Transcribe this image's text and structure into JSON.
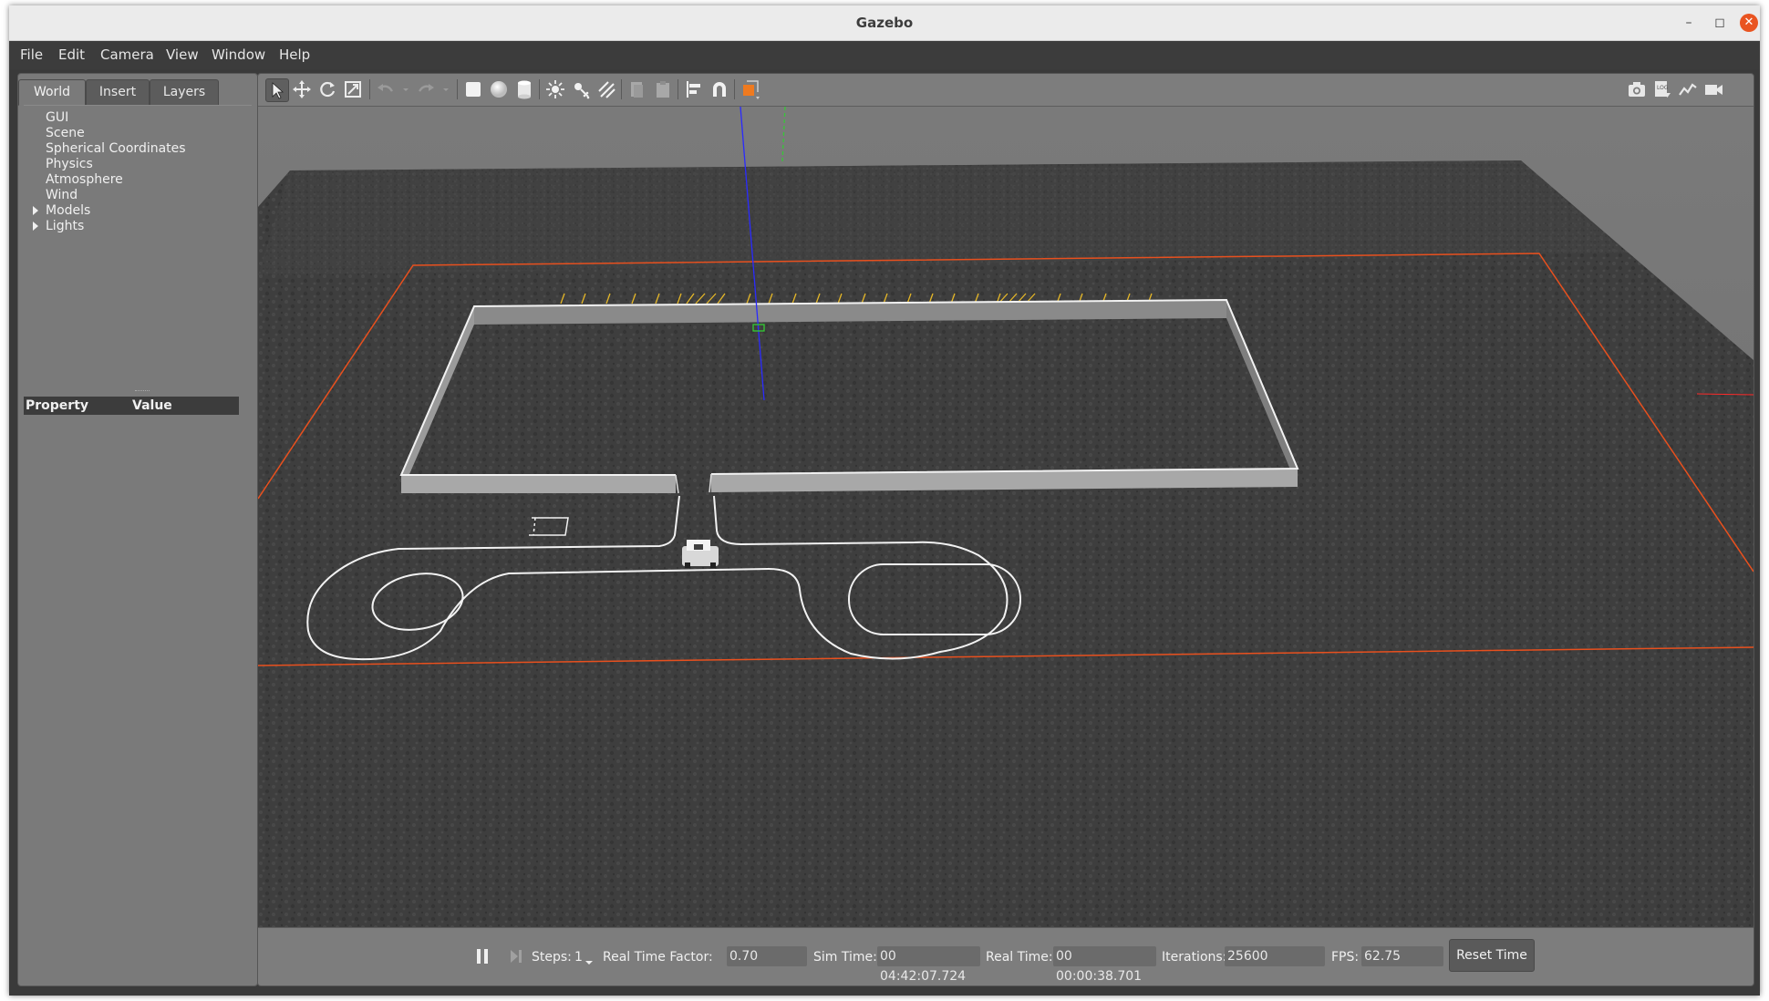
{
  "window": {
    "title": "Gazebo"
  },
  "menu": [
    {
      "label": "File"
    },
    {
      "label": "Edit"
    },
    {
      "label": "Camera"
    },
    {
      "label": "View"
    },
    {
      "label": "Window"
    },
    {
      "label": "Help"
    }
  ],
  "left_panel": {
    "tabs": [
      "World",
      "Insert",
      "Layers"
    ],
    "active_tab": "World",
    "tree": [
      {
        "label": "GUI"
      },
      {
        "label": "Scene"
      },
      {
        "label": "Spherical Coordinates"
      },
      {
        "label": "Physics"
      },
      {
        "label": "Atmosphere"
      },
      {
        "label": "Wind"
      },
      {
        "label": "Models",
        "expandable": true
      },
      {
        "label": "Lights",
        "expandable": true
      }
    ],
    "property_header": {
      "property": "Property",
      "value": "Value"
    }
  },
  "toolbar": {
    "left_icons": [
      "select-arrow-icon",
      "translate-icon",
      "rotate-icon",
      "scale-icon",
      "undo-icon",
      "undo-dropdown-icon",
      "redo-icon",
      "redo-dropdown-icon",
      "box-icon",
      "sphere-icon",
      "cylinder-icon",
      "point-light-icon",
      "spot-light-icon",
      "directional-light-icon",
      "copy-icon",
      "paste-icon",
      "align-icon",
      "snap-magnet-icon",
      "change-view-icon"
    ],
    "right_icons": [
      "screenshot-icon",
      "log-icon",
      "plot-icon",
      "record-video-icon"
    ]
  },
  "status": {
    "steps_label": "Steps:",
    "steps_value": "1",
    "rtf_label": "Real Time Factor:",
    "rtf_value": "0.70",
    "sim_time_label": "Sim Time:",
    "sim_time_value": "00 04:42:07.724",
    "real_time_label": "Real Time:",
    "real_time_value": "00 00:00:38.701",
    "iterations_label": "Iterations:",
    "iterations_value": "25600",
    "fps_label": "FPS:",
    "fps_value": "62.75",
    "reset_label": "Reset Time"
  },
  "colors": {
    "ground": "#3f3f3f",
    "boundary_line": "#e8501e",
    "track_line": "#f2f2f2",
    "wall": "#8c8c8c",
    "ruler_marks": "#e6b828",
    "axis_z": "#2a2aff",
    "axis_y": "#33cc33",
    "axis_x": "#ff2a2a"
  }
}
